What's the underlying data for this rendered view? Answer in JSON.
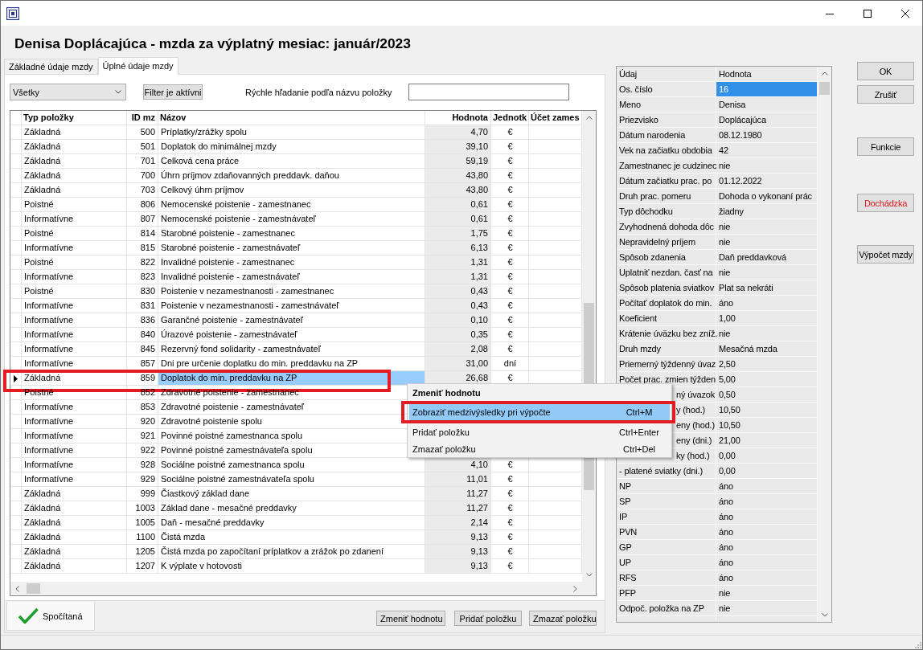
{
  "heading": "Denisa Doplácajúca - mzda za výplatný mesiac: január/2023",
  "tabs": [
    {
      "label": "Základné údaje mzdy",
      "selected": false
    },
    {
      "label": "Úplné údaje mzdy",
      "selected": true
    }
  ],
  "filters": {
    "dropdown": "Všetky",
    "filter_button": "Filter je aktívni",
    "search_label": "Rýchle hľadanie podľa názvu položky"
  },
  "table": {
    "columns": [
      "Typ položky",
      "ID mz",
      "Názov",
      "Hodnota",
      "Jednotk",
      "Účet zames"
    ],
    "rows": [
      {
        "type": "Základná",
        "id": "500",
        "name": "Príplatky/zrážky spolu",
        "value": "4,70",
        "unit": "€",
        "selected": false,
        "callout": false
      },
      {
        "type": "Základná",
        "id": "501",
        "name": "Doplatok do minimálnej mzdy",
        "value": "39,10",
        "unit": "€",
        "selected": false,
        "callout": false
      },
      {
        "type": "Základná",
        "id": "701",
        "name": "Celková cena práce",
        "value": "59,19",
        "unit": "€",
        "selected": false,
        "callout": false
      },
      {
        "type": "Základná",
        "id": "700",
        "name": "Úhrn príjmov zdaňovanných preddavk. daňou",
        "value": "43,80",
        "unit": "€",
        "selected": false,
        "callout": false
      },
      {
        "type": "Základná",
        "id": "703",
        "name": "Celkový úhrn príjmov",
        "value": "43,80",
        "unit": "€",
        "selected": false,
        "callout": false
      },
      {
        "type": "Poistné",
        "id": "806",
        "name": "Nemocenské poistenie - zamestnanec",
        "value": "0,61",
        "unit": "€",
        "selected": false,
        "callout": false
      },
      {
        "type": "Informatívne",
        "id": "807",
        "name": "Nemocenské poistenie - zamestnávateľ",
        "value": "0,61",
        "unit": "€",
        "selected": false,
        "callout": false
      },
      {
        "type": "Poistné",
        "id": "814",
        "name": "Starobné poistenie - zamestnanec",
        "value": "1,75",
        "unit": "€",
        "selected": false,
        "callout": false
      },
      {
        "type": "Informatívne",
        "id": "815",
        "name": "Starobné poistenie - zamestnávateľ",
        "value": "6,13",
        "unit": "€",
        "selected": false,
        "callout": false
      },
      {
        "type": "Poistné",
        "id": "822",
        "name": "Invalidné poistenie - zamestnanec",
        "value": "1,31",
        "unit": "€",
        "selected": false,
        "callout": false
      },
      {
        "type": "Informatívne",
        "id": "823",
        "name": "Invalidné poistenie - zamestnávateľ",
        "value": "1,31",
        "unit": "€",
        "selected": false,
        "callout": false
      },
      {
        "type": "Poistné",
        "id": "830",
        "name": "Poistenie v nezamestnanosti - zamestnanec",
        "value": "0,43",
        "unit": "€",
        "selected": false,
        "callout": false
      },
      {
        "type": "Informatívne",
        "id": "831",
        "name": "Poistenie v nezamestnanosti - zamestnávateľ",
        "value": "0,43",
        "unit": "€",
        "selected": false,
        "callout": false
      },
      {
        "type": "Informatívne",
        "id": "836",
        "name": "Garančné poistenie - zamestnávateľ",
        "value": "0,10",
        "unit": "€",
        "selected": false,
        "callout": false
      },
      {
        "type": "Informatívne",
        "id": "840",
        "name": "Úrazové poistenie - zamestnávateľ",
        "value": "0,35",
        "unit": "€",
        "selected": false,
        "callout": false
      },
      {
        "type": "Informatívne",
        "id": "845",
        "name": "Rezervný fond solidarity - zamestnávateľ",
        "value": "2,08",
        "unit": "€",
        "selected": false,
        "callout": false
      },
      {
        "type": "Informatívne",
        "id": "857",
        "name": "Dni pre určenie doplatku do min. preddavku na ZP",
        "value": "31,00",
        "unit": "dní",
        "selected": false,
        "callout": false
      },
      {
        "type": "Základná",
        "id": "859",
        "name": "Doplatok do min. preddavku na ZP",
        "value": "26,68",
        "unit": "€",
        "selected": true,
        "callout": true
      },
      {
        "type": "Poistné",
        "id": "852",
        "name": "Zdravotné poistenie - zamestnanec",
        "selected": false,
        "callout": false
      },
      {
        "type": "Informatívne",
        "id": "853",
        "name": "Zdravotné poistenie - zamestnávateľ",
        "selected": false,
        "callout": false
      },
      {
        "type": "Informatívne",
        "id": "920",
        "name": "Zdravotné poistenie spolu",
        "selected": false,
        "callout": false
      },
      {
        "type": "Informatívne",
        "id": "921",
        "name": "Povinné poistné zamestnanca spolu",
        "selected": false,
        "callout": false
      },
      {
        "type": "Informatívne",
        "id": "922",
        "name": "Povinné poistné zamestnávateľa spolu",
        "selected": false,
        "callout": false
      },
      {
        "type": "Informatívne",
        "id": "928",
        "name": "Sociálne poistné zamestnanca spolu",
        "value": "4,10",
        "unit": "€",
        "selected": false,
        "callout": false
      },
      {
        "type": "Informatívne",
        "id": "929",
        "name": "Sociálne poistné zamestnávateľa spolu",
        "value": "11,01",
        "unit": "€",
        "selected": false,
        "callout": false
      },
      {
        "type": "Základná",
        "id": "999",
        "name": "Čiastkový základ dane",
        "value": "11,27",
        "unit": "€",
        "selected": false,
        "callout": false
      },
      {
        "type": "Základná",
        "id": "1003",
        "name": "Základ dane - mesačné preddavky",
        "value": "11,27",
        "unit": "€",
        "selected": false,
        "callout": false
      },
      {
        "type": "Základná",
        "id": "1005",
        "name": "Daň - mesačné preddavky",
        "value": "2,14",
        "unit": "€",
        "selected": false,
        "callout": false
      },
      {
        "type": "Základná",
        "id": "1100",
        "name": "Čistá mzda",
        "value": "9,13",
        "unit": "€",
        "selected": false,
        "callout": false
      },
      {
        "type": "Základná",
        "id": "1205",
        "name": "Čistá mzda po započítaní príplatkov a zrážok po zdanení",
        "value": "9,13",
        "unit": "€",
        "selected": false,
        "callout": false
      },
      {
        "type": "Základná",
        "id": "1207",
        "name": "K výplate v hotovosti",
        "value": "9,13",
        "unit": "€",
        "selected": false,
        "callout": false
      }
    ]
  },
  "status_tab": {
    "label": "Spočítaná"
  },
  "action_buttons": [
    "Zmeniť hodnotu",
    "Pridať položku",
    "Zmazať položku"
  ],
  "details": {
    "columns": [
      "Údaj",
      "Hodnota"
    ],
    "rows": [
      {
        "label": "Os. číslo",
        "value": "16",
        "selected": true,
        "kind": "plain"
      },
      {
        "label": "Meno",
        "value": "Denisa",
        "selected": false,
        "kind": "plain"
      },
      {
        "label": "Priezvisko",
        "value": "Doplácajúca",
        "selected": false,
        "kind": "plain"
      },
      {
        "label": "Dátum narodenia",
        "value": "08.12.1980",
        "selected": false,
        "kind": "plain"
      },
      {
        "label": "Vek na začiatku obdobia",
        "value": "42",
        "selected": false,
        "kind": "plain"
      },
      {
        "label": "Zamestnanec je cudzinec",
        "value": "nie",
        "selected": false,
        "kind": "plain"
      },
      {
        "label": "Dátum začiatku prac. po",
        "value": "01.12.2022",
        "selected": false,
        "kind": "plain"
      },
      {
        "label": "Druh prac. pomeru",
        "value": "Dohoda o vykonaní prác",
        "selected": false,
        "kind": "plain"
      },
      {
        "label": "Typ dôchodku",
        "value": "žiadny",
        "selected": false,
        "kind": "plain"
      },
      {
        "label": "Zvyhodnená dohoda dôc",
        "value": "nie",
        "selected": false,
        "kind": "plain"
      },
      {
        "label": "Nepravidelný príjem",
        "value": "nie",
        "selected": false,
        "kind": "plain"
      },
      {
        "label": "Spôsob zdanenia",
        "value": "Daň preddavková",
        "selected": false,
        "kind": "plain"
      },
      {
        "label": "Uplatniť nezdan. časť na",
        "value": "nie",
        "selected": false,
        "kind": "plain"
      },
      {
        "label": "Spôsob platenia sviatkov",
        "value": "Plat sa nekráti",
        "selected": false,
        "kind": "plain"
      },
      {
        "label": "Počítať doplatok do min.",
        "value": "áno",
        "selected": false,
        "kind": "plain"
      },
      {
        "label": "Koeficient",
        "value": "1,00",
        "selected": false,
        "kind": "plain"
      },
      {
        "label": "Krátenie úväzku bez zníž.",
        "value": "nie",
        "selected": false,
        "kind": "plain"
      },
      {
        "label": "Druh mzdy",
        "value": "Mesačná mzda",
        "selected": false,
        "kind": "plain"
      },
      {
        "label": "Priemerný týždenný úvaz",
        "value": "2,50",
        "selected": false,
        "kind": "plain"
      },
      {
        "label": "Počet prac. zmien týžden",
        "value": "5,00",
        "selected": false,
        "kind": "plain"
      },
      {
        "label": "ný úvazok",
        "value": "0,50",
        "selected": false,
        "kind": "tail"
      },
      {
        "label": "y (hod.)",
        "value": "10,50",
        "selected": false,
        "kind": "tail"
      },
      {
        "label": "eny (hod.)",
        "value": "10,50",
        "selected": false,
        "kind": "tail"
      },
      {
        "label": "eny (dni.)",
        "value": "21,00",
        "selected": false,
        "kind": "tail"
      },
      {
        "label": "ky (hod.)",
        "value": "0,00",
        "selected": false,
        "kind": "tail"
      },
      {
        "label": "- platené sviatky (dni.)",
        "value": "0,00",
        "selected": false,
        "kind": "plain"
      },
      {
        "label": "NP",
        "value": "áno",
        "selected": false,
        "kind": "plain"
      },
      {
        "label": "SP",
        "value": "áno",
        "selected": false,
        "kind": "plain"
      },
      {
        "label": "IP",
        "value": "áno",
        "selected": false,
        "kind": "plain"
      },
      {
        "label": "PVN",
        "value": "áno",
        "selected": false,
        "kind": "plain"
      },
      {
        "label": "GP",
        "value": "áno",
        "selected": false,
        "kind": "plain"
      },
      {
        "label": "UP",
        "value": "áno",
        "selected": false,
        "kind": "plain"
      },
      {
        "label": "RFS",
        "value": "áno",
        "selected": false,
        "kind": "plain"
      },
      {
        "label": "PFP",
        "value": "nie",
        "selected": false,
        "kind": "plain"
      },
      {
        "label": "Odpoč. položka na ZP",
        "value": "nie",
        "selected": false,
        "kind": "plain"
      }
    ]
  },
  "side_buttons": [
    {
      "label": "OK",
      "kind": "normal"
    },
    {
      "label": "Zrušiť",
      "kind": "normal"
    },
    {
      "label": "Funkcie",
      "kind": "normal"
    },
    {
      "label": "Dochádzka",
      "kind": "alert"
    },
    {
      "label": "Výpočet mzdy",
      "kind": "normal"
    }
  ],
  "context_menu": {
    "items": [
      {
        "label": "Zmeniť hodnotu",
        "kind": "default",
        "selected": false,
        "callout": false
      },
      {
        "label": "Zobraziť medzivýsledky pri výpočte",
        "shortcut": "Ctrl+M",
        "kind": "normal",
        "selected": true,
        "callout": true
      },
      {
        "label": "Pridať položku",
        "shortcut": "Ctrl+Enter",
        "kind": "normal",
        "selected": false,
        "callout": false
      },
      {
        "label": "Zmazať položku",
        "shortcut": "Ctrl+Del",
        "kind": "normal",
        "selected": false,
        "callout": false
      }
    ]
  }
}
